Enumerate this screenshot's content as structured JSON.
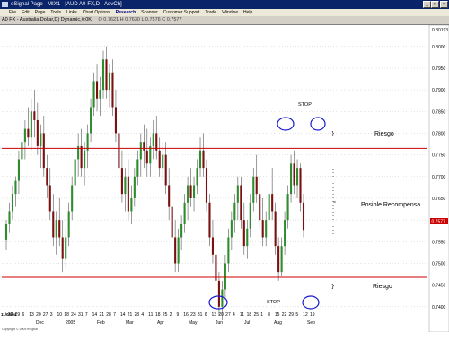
{
  "window": {
    "title": "eSignal Page - MIX1 - [AUD A0-FX,D - AdvCh]",
    "controls": [
      "_",
      "□",
      "×"
    ]
  },
  "menu": [
    "File",
    "Edit",
    "Page",
    "Tools",
    "Links",
    "Chart Options",
    "Research",
    "Scanner",
    "Customer Support",
    "Trade",
    "Window",
    "Help"
  ],
  "chart_header": {
    "title": "A0 FX - Australia Dollar,D) Dynamic,#:0K",
    "indicator_values": "O 0.7621  H 0.7630  L 0.7576  C 0.7577"
  },
  "chart_data": {
    "type": "candlestick",
    "instrument": "AUD A0-FX",
    "interval": "D",
    "y_ticks": [
      0.74,
      0.745,
      0.75,
      0.755,
      0.76,
      0.765,
      0.77,
      0.775,
      0.78,
      0.785,
      0.79,
      0.795,
      0.8
    ],
    "ylim": [
      0.735,
      0.8045
    ],
    "top_label": "0.80193",
    "last_price_label": "0.7577",
    "up_color": "#2e8b2e",
    "down_color": "#7a1010",
    "resistance_line": 0.7765,
    "support_line": 0.7468,
    "x_labels": [
      "11/08/04",
      "22",
      "29",
      "6",
      "13",
      "20",
      "27",
      "3",
      "10",
      "18",
      "24",
      "31",
      "7",
      "14",
      "21",
      "28",
      "7",
      "14",
      "21",
      "28",
      "4",
      "11",
      "18",
      "25",
      "2",
      "9",
      "16",
      "23",
      "31",
      "6",
      "13",
      "20",
      "27",
      "4",
      "11",
      "18",
      "25",
      "1",
      "8",
      "15",
      "22",
      "29",
      "5",
      "12",
      "19"
    ],
    "month_labels": [
      "Dec",
      "2005",
      "Feb",
      "Mar",
      "Apr",
      "May",
      "Jun",
      "Jul",
      "Aug",
      "Sep"
    ],
    "candles": [
      [
        0.7555,
        0.76,
        0.753,
        0.759
      ],
      [
        0.759,
        0.764,
        0.757,
        0.762
      ],
      [
        0.762,
        0.768,
        0.76,
        0.766
      ],
      [
        0.766,
        0.77,
        0.763,
        0.769
      ],
      [
        0.769,
        0.776,
        0.766,
        0.774
      ],
      [
        0.774,
        0.78,
        0.77,
        0.778
      ],
      [
        0.778,
        0.783,
        0.774,
        0.781
      ],
      [
        0.781,
        0.786,
        0.777,
        0.779
      ],
      [
        0.779,
        0.788,
        0.776,
        0.785
      ],
      [
        0.785,
        0.79,
        0.779,
        0.783
      ],
      [
        0.783,
        0.787,
        0.775,
        0.777
      ],
      [
        0.777,
        0.782,
        0.772,
        0.78
      ],
      [
        0.78,
        0.784,
        0.77,
        0.772
      ],
      [
        0.772,
        0.775,
        0.765,
        0.768
      ],
      [
        0.768,
        0.772,
        0.76,
        0.762
      ],
      [
        0.762,
        0.766,
        0.754,
        0.756
      ],
      [
        0.756,
        0.762,
        0.752,
        0.76
      ],
      [
        0.76,
        0.765,
        0.754,
        0.756
      ],
      [
        0.756,
        0.76,
        0.748,
        0.751
      ],
      [
        0.751,
        0.758,
        0.749,
        0.756
      ],
      [
        0.756,
        0.764,
        0.754,
        0.762
      ],
      [
        0.762,
        0.77,
        0.76,
        0.768
      ],
      [
        0.768,
        0.776,
        0.765,
        0.774
      ],
      [
        0.774,
        0.78,
        0.77,
        0.777
      ],
      [
        0.777,
        0.781,
        0.77,
        0.772
      ],
      [
        0.772,
        0.778,
        0.768,
        0.776
      ],
      [
        0.776,
        0.782,
        0.772,
        0.78
      ],
      [
        0.78,
        0.788,
        0.778,
        0.786
      ],
      [
        0.786,
        0.794,
        0.784,
        0.792
      ],
      [
        0.792,
        0.796,
        0.785,
        0.788
      ],
      [
        0.788,
        0.793,
        0.784,
        0.79
      ],
      [
        0.79,
        0.799,
        0.788,
        0.797
      ],
      [
        0.797,
        0.8,
        0.788,
        0.79
      ],
      [
        0.79,
        0.796,
        0.786,
        0.794
      ],
      [
        0.794,
        0.797,
        0.784,
        0.786
      ],
      [
        0.786,
        0.79,
        0.778,
        0.78
      ],
      [
        0.78,
        0.784,
        0.77,
        0.772
      ],
      [
        0.772,
        0.776,
        0.764,
        0.766
      ],
      [
        0.766,
        0.772,
        0.762,
        0.77
      ],
      [
        0.77,
        0.774,
        0.76,
        0.762
      ],
      [
        0.762,
        0.768,
        0.759,
        0.765
      ],
      [
        0.765,
        0.772,
        0.763,
        0.77
      ],
      [
        0.77,
        0.776,
        0.768,
        0.774
      ],
      [
        0.774,
        0.78,
        0.77,
        0.778
      ],
      [
        0.778,
        0.782,
        0.772,
        0.776
      ],
      [
        0.776,
        0.781,
        0.77,
        0.773
      ],
      [
        0.773,
        0.779,
        0.77,
        0.777
      ],
      [
        0.777,
        0.783,
        0.774,
        0.78
      ],
      [
        0.78,
        0.784,
        0.774,
        0.776
      ],
      [
        0.776,
        0.779,
        0.77,
        0.772
      ],
      [
        0.772,
        0.778,
        0.769,
        0.775
      ],
      [
        0.775,
        0.778,
        0.766,
        0.768
      ],
      [
        0.768,
        0.772,
        0.76,
        0.763
      ],
      [
        0.763,
        0.766,
        0.754,
        0.756
      ],
      [
        0.756,
        0.76,
        0.748,
        0.75
      ],
      [
        0.75,
        0.758,
        0.748,
        0.756
      ],
      [
        0.756,
        0.761,
        0.753,
        0.759
      ],
      [
        0.759,
        0.766,
        0.757,
        0.764
      ],
      [
        0.764,
        0.77,
        0.76,
        0.768
      ],
      [
        0.768,
        0.772,
        0.763,
        0.765
      ],
      [
        0.765,
        0.77,
        0.762,
        0.768
      ],
      [
        0.768,
        0.774,
        0.766,
        0.772
      ],
      [
        0.772,
        0.779,
        0.77,
        0.776
      ],
      [
        0.776,
        0.78,
        0.77,
        0.772
      ],
      [
        0.772,
        0.774,
        0.762,
        0.764
      ],
      [
        0.764,
        0.766,
        0.754,
        0.756
      ],
      [
        0.756,
        0.76,
        0.75,
        0.752
      ],
      [
        0.752,
        0.756,
        0.744,
        0.746
      ],
      [
        0.746,
        0.748,
        0.738,
        0.74
      ],
      [
        0.74,
        0.746,
        0.737,
        0.744
      ],
      [
        0.744,
        0.752,
        0.742,
        0.75
      ],
      [
        0.75,
        0.758,
        0.748,
        0.756
      ],
      [
        0.756,
        0.762,
        0.753,
        0.76
      ],
      [
        0.76,
        0.766,
        0.757,
        0.764
      ],
      [
        0.764,
        0.77,
        0.76,
        0.768
      ],
      [
        0.768,
        0.77,
        0.758,
        0.76
      ],
      [
        0.76,
        0.764,
        0.752,
        0.754
      ],
      [
        0.754,
        0.76,
        0.751,
        0.758
      ],
      [
        0.758,
        0.766,
        0.756,
        0.764
      ],
      [
        0.764,
        0.772,
        0.762,
        0.77
      ],
      [
        0.77,
        0.775,
        0.764,
        0.766
      ],
      [
        0.766,
        0.77,
        0.758,
        0.76
      ],
      [
        0.76,
        0.765,
        0.754,
        0.756
      ],
      [
        0.756,
        0.762,
        0.754,
        0.76
      ],
      [
        0.76,
        0.768,
        0.758,
        0.766
      ],
      [
        0.766,
        0.772,
        0.76,
        0.762
      ],
      [
        0.762,
        0.764,
        0.752,
        0.754
      ],
      [
        0.754,
        0.756,
        0.746,
        0.748
      ],
      [
        0.748,
        0.756,
        0.747,
        0.754
      ],
      [
        0.754,
        0.762,
        0.752,
        0.76
      ],
      [
        0.76,
        0.768,
        0.758,
        0.766
      ],
      [
        0.766,
        0.775,
        0.764,
        0.773
      ],
      [
        0.773,
        0.776,
        0.766,
        0.768
      ],
      [
        0.768,
        0.774,
        0.765,
        0.772
      ],
      [
        0.772,
        0.773,
        0.762,
        0.764
      ],
      [
        0.764,
        0.766,
        0.756,
        0.7577
      ]
    ]
  },
  "annotations": {
    "stop_top": "STOP",
    "stop_bottom": "STOP",
    "riesgo_top": "Riesgo",
    "riesgo_bottom": "Riesgo",
    "possible_reward": "Posible Recompensa",
    "copyright": "Copyright © 2005 eSignal"
  }
}
